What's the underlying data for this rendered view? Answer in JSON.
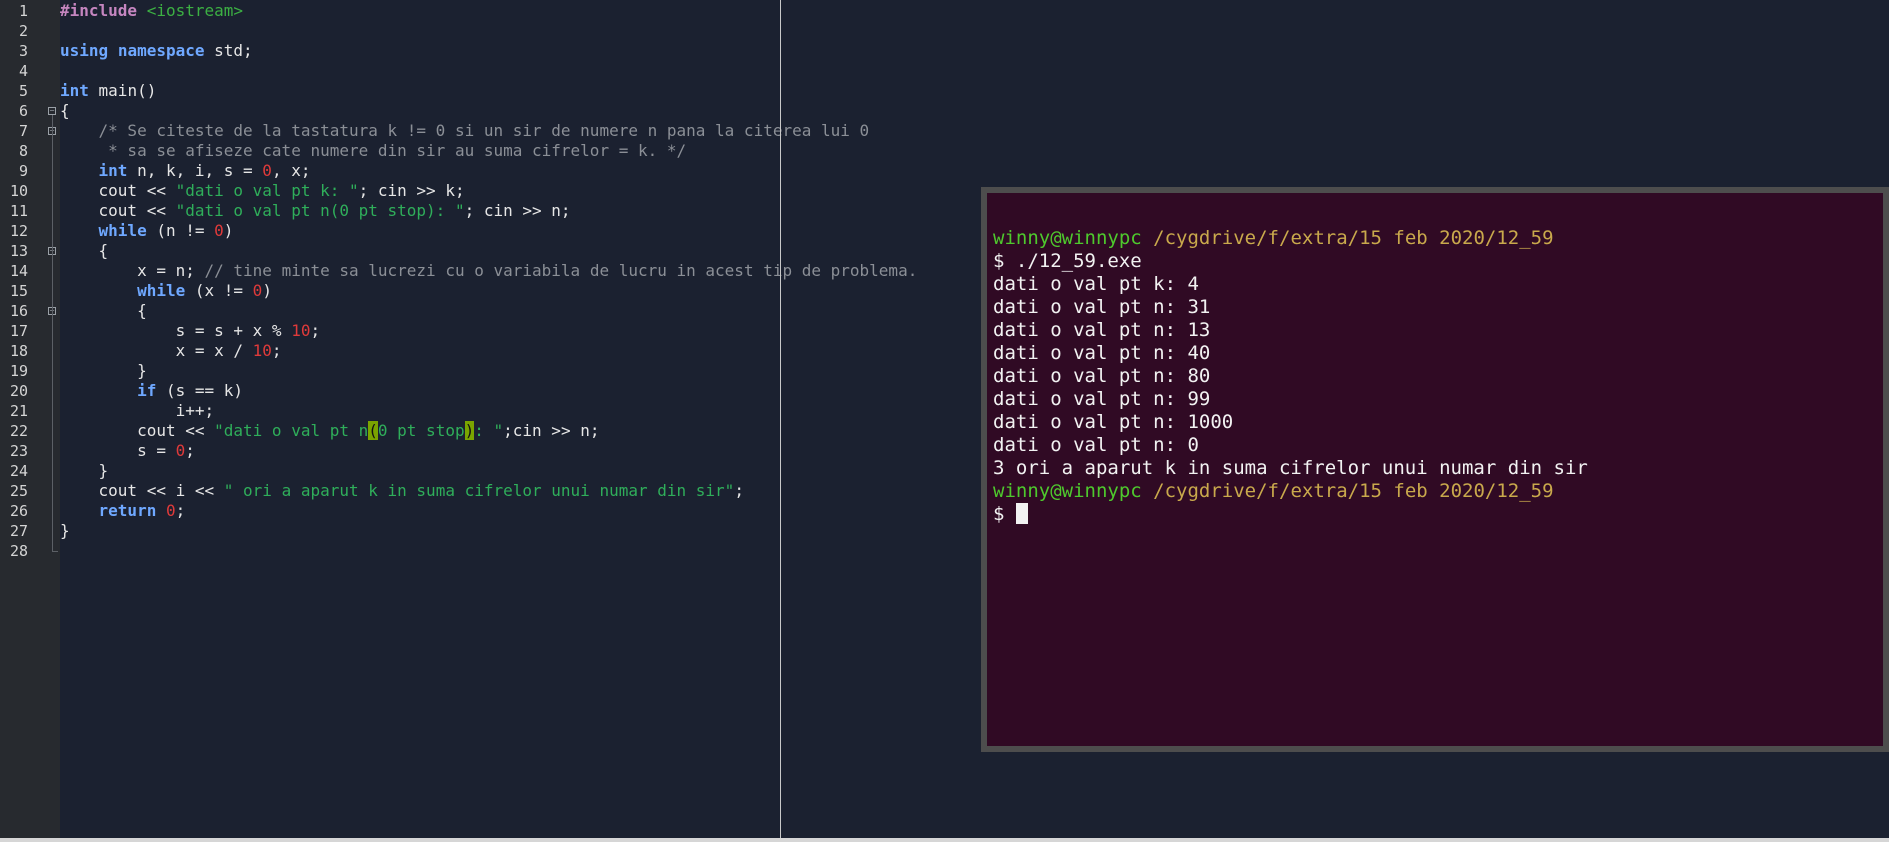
{
  "editor": {
    "lines": [
      {
        "n": "1",
        "segs": [
          {
            "t": "#include",
            "c": "pp"
          },
          {
            "t": " ",
            "c": ""
          },
          {
            "t": "<iostream>",
            "c": "inc"
          }
        ]
      },
      {
        "n": "2",
        "segs": []
      },
      {
        "n": "3",
        "segs": [
          {
            "t": "using",
            "c": "kw"
          },
          {
            "t": " ",
            "c": ""
          },
          {
            "t": "namespace",
            "c": "kw"
          },
          {
            "t": " std;",
            "c": ""
          }
        ]
      },
      {
        "n": "4",
        "segs": []
      },
      {
        "n": "5",
        "segs": [
          {
            "t": "int",
            "c": "kw"
          },
          {
            "t": " main()",
            "c": ""
          }
        ]
      },
      {
        "n": "6",
        "segs": [
          {
            "t": "{",
            "c": ""
          }
        ]
      },
      {
        "n": "7",
        "segs": [
          {
            "t": "    /* Se citeste de la tastatura k != 0 si un sir de numere n pana la citerea lui 0",
            "c": "cm"
          }
        ]
      },
      {
        "n": "8",
        "segs": [
          {
            "t": "     * sa se afiseze cate numere din sir au suma cifrelor = k. */",
            "c": "cm"
          }
        ]
      },
      {
        "n": "9",
        "segs": [
          {
            "t": "    ",
            "c": ""
          },
          {
            "t": "int",
            "c": "kw"
          },
          {
            "t": " n, k, i, s = ",
            "c": ""
          },
          {
            "t": "0",
            "c": "num"
          },
          {
            "t": ", x;",
            "c": ""
          }
        ]
      },
      {
        "n": "10",
        "segs": [
          {
            "t": "    cout << ",
            "c": ""
          },
          {
            "t": "\"dati o val pt k: \"",
            "c": "str"
          },
          {
            "t": "; cin >> k;",
            "c": ""
          }
        ]
      },
      {
        "n": "11",
        "segs": [
          {
            "t": "    cout << ",
            "c": ""
          },
          {
            "t": "\"dati o val pt n(0 pt stop): \"",
            "c": "str"
          },
          {
            "t": "; cin >> n;",
            "c": ""
          }
        ]
      },
      {
        "n": "12",
        "segs": [
          {
            "t": "    ",
            "c": ""
          },
          {
            "t": "while",
            "c": "kw"
          },
          {
            "t": " (n != ",
            "c": ""
          },
          {
            "t": "0",
            "c": "num"
          },
          {
            "t": ")",
            "c": ""
          }
        ]
      },
      {
        "n": "13",
        "segs": [
          {
            "t": "    {",
            "c": ""
          }
        ]
      },
      {
        "n": "14",
        "segs": [
          {
            "t": "        x = n; ",
            "c": ""
          },
          {
            "t": "// tine minte sa lucrezi cu o variabila de lucru in acest tip de problema.",
            "c": "cm"
          }
        ]
      },
      {
        "n": "15",
        "segs": [
          {
            "t": "        ",
            "c": ""
          },
          {
            "t": "while",
            "c": "kw"
          },
          {
            "t": " (x != ",
            "c": ""
          },
          {
            "t": "0",
            "c": "num"
          },
          {
            "t": ")",
            "c": ""
          }
        ]
      },
      {
        "n": "16",
        "segs": [
          {
            "t": "        {",
            "c": ""
          }
        ]
      },
      {
        "n": "17",
        "segs": [
          {
            "t": "            s = s + x % ",
            "c": ""
          },
          {
            "t": "10",
            "c": "num"
          },
          {
            "t": ";",
            "c": ""
          }
        ]
      },
      {
        "n": "18",
        "segs": [
          {
            "t": "            x = x / ",
            "c": ""
          },
          {
            "t": "10",
            "c": "num"
          },
          {
            "t": ";",
            "c": ""
          }
        ]
      },
      {
        "n": "19",
        "segs": [
          {
            "t": "        }",
            "c": ""
          }
        ]
      },
      {
        "n": "20",
        "segs": [
          {
            "t": "        ",
            "c": ""
          },
          {
            "t": "if",
            "c": "kw"
          },
          {
            "t": " (s == k)",
            "c": ""
          }
        ]
      },
      {
        "n": "21",
        "segs": [
          {
            "t": "            i++;",
            "c": ""
          }
        ]
      },
      {
        "n": "22",
        "segs": [
          {
            "t": "        cout << ",
            "c": ""
          },
          {
            "t": "\"dati o val pt n",
            "c": "str"
          },
          {
            "t": "(",
            "c": "br"
          },
          {
            "t": "0 pt stop",
            "c": "str"
          },
          {
            "t": ")",
            "c": "br"
          },
          {
            "t": ": \"",
            "c": "str"
          },
          {
            "t": ";cin >> n;",
            "c": ""
          }
        ]
      },
      {
        "n": "23",
        "segs": [
          {
            "t": "        s = ",
            "c": ""
          },
          {
            "t": "0",
            "c": "num"
          },
          {
            "t": ";",
            "c": ""
          }
        ]
      },
      {
        "n": "24",
        "segs": [
          {
            "t": "    }",
            "c": ""
          }
        ]
      },
      {
        "n": "25",
        "segs": [
          {
            "t": "    cout << i << ",
            "c": ""
          },
          {
            "t": "\" ori a aparut k in suma cifrelor unui numar din sir\"",
            "c": "str"
          },
          {
            "t": ";",
            "c": ""
          }
        ]
      },
      {
        "n": "26",
        "segs": [
          {
            "t": "    ",
            "c": ""
          },
          {
            "t": "return",
            "c": "kw"
          },
          {
            "t": " ",
            "c": ""
          },
          {
            "t": "0",
            "c": "num"
          },
          {
            "t": ";",
            "c": ""
          }
        ]
      },
      {
        "n": "27",
        "segs": [
          {
            "t": "}",
            "c": ""
          }
        ]
      },
      {
        "n": "28",
        "segs": []
      }
    ]
  },
  "terminal": {
    "lines": [
      {
        "segs": [
          {
            "t": "winny@winnypc",
            "c": "user"
          },
          {
            "t": " ",
            "c": ""
          },
          {
            "t": "/cygdrive/f/extra/15 feb 2020/12_59",
            "c": "path"
          }
        ]
      },
      {
        "segs": [
          {
            "t": "$ ./12_59.exe",
            "c": ""
          }
        ]
      },
      {
        "segs": [
          {
            "t": "dati o val pt k: 4",
            "c": ""
          }
        ]
      },
      {
        "segs": [
          {
            "t": "dati o val pt n: 31",
            "c": ""
          }
        ]
      },
      {
        "segs": [
          {
            "t": "dati o val pt n: 13",
            "c": ""
          }
        ]
      },
      {
        "segs": [
          {
            "t": "dati o val pt n: 40",
            "c": ""
          }
        ]
      },
      {
        "segs": [
          {
            "t": "dati o val pt n: 80",
            "c": ""
          }
        ]
      },
      {
        "segs": [
          {
            "t": "dati o val pt n: 99",
            "c": ""
          }
        ]
      },
      {
        "segs": [
          {
            "t": "dati o val pt n: 1000",
            "c": ""
          }
        ]
      },
      {
        "segs": [
          {
            "t": "dati o val pt n: 0",
            "c": ""
          }
        ]
      },
      {
        "segs": [
          {
            "t": "3 ori a aparut k in suma cifrelor unui numar din sir",
            "c": ""
          }
        ]
      },
      {
        "segs": [
          {
            "t": "winny@winnypc",
            "c": "user"
          },
          {
            "t": " ",
            "c": ""
          },
          {
            "t": "/cygdrive/f/extra/15 feb 2020/12_59",
            "c": "path"
          }
        ]
      },
      {
        "segs": [
          {
            "t": "$ ",
            "c": ""
          }
        ],
        "cursor": true
      }
    ]
  }
}
